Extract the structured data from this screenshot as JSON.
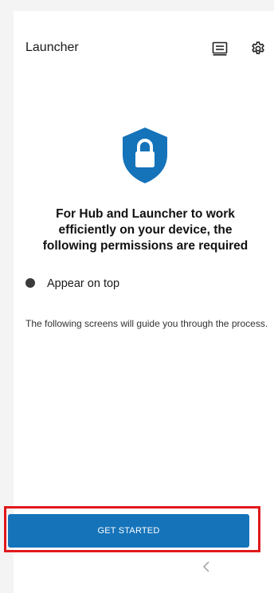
{
  "header": {
    "title": "Launcher",
    "news_icon": "news-feed-icon",
    "settings_icon": "gear-icon"
  },
  "hero": {
    "icon": "shield-lock-icon",
    "headline_line1": "For Hub and Launcher to work",
    "headline_line2": "efficiently on your device, the",
    "headline_line3": "following permissions are required"
  },
  "permissions": [
    {
      "label": "Appear on top"
    }
  ],
  "guide_text": "The following screens will guide you through the process.",
  "cta": {
    "label": "GET STARTED"
  },
  "nav": {
    "back_icon": "chevron-left-icon"
  },
  "colors": {
    "accent": "#1573ba",
    "highlight_border": "#e0191c",
    "background": "#ffffff"
  }
}
